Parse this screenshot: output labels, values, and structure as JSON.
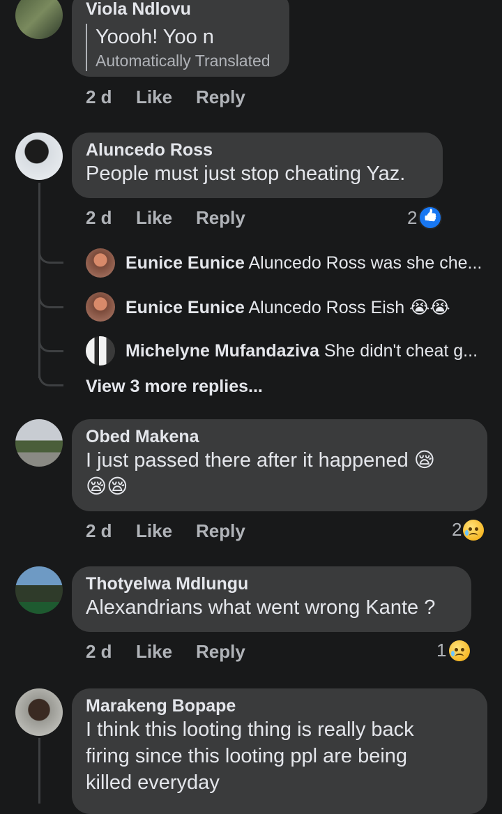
{
  "actions": {
    "like": "Like",
    "reply": "Reply"
  },
  "comments": [
    {
      "name": "Viola Ndlovu",
      "text": "Yoooh! Yoo n",
      "translation_note": "Automatically Translated",
      "time": "2 d"
    },
    {
      "name": "Aluncedo Ross",
      "text": "People must just stop cheating Yaz.",
      "time": "2 d",
      "reaction_count": "2",
      "reaction_icon": "like-icon",
      "replies": [
        {
          "name": "Eunice Eunice",
          "text": "Aluncedo Ross was she che..."
        },
        {
          "name": "Eunice Eunice",
          "text": "Aluncedo Ross Eish 😭😭"
        },
        {
          "name": "Michelyne Mufandaziva",
          "text": "She didn't  cheat g..."
        }
      ],
      "more_replies": "View 3 more replies..."
    },
    {
      "name": "Obed Makena",
      "text_line1": "I just passed there after it happened 😪",
      "text_line2": "😪😪",
      "time": "2 d",
      "reaction_count": "2",
      "reaction_icon": "sad-face-icon"
    },
    {
      "name": "Thotyelwa Mdlungu",
      "text": "Alexandrians what went wrong Kante ?",
      "time": "2 d",
      "reaction_count": "1",
      "reaction_icon": "sad-face-icon"
    },
    {
      "name": "Marakeng Bopape",
      "text_line1": "I think this looting thing is really back",
      "text_line2": "firing since this looting ppl are being",
      "text_line3": "killed everyday"
    }
  ],
  "colors": {
    "background": "#18191a",
    "bubble": "#3a3b3c",
    "secondary_text": "#b0b3b8",
    "like_blue": "#1877f2"
  }
}
